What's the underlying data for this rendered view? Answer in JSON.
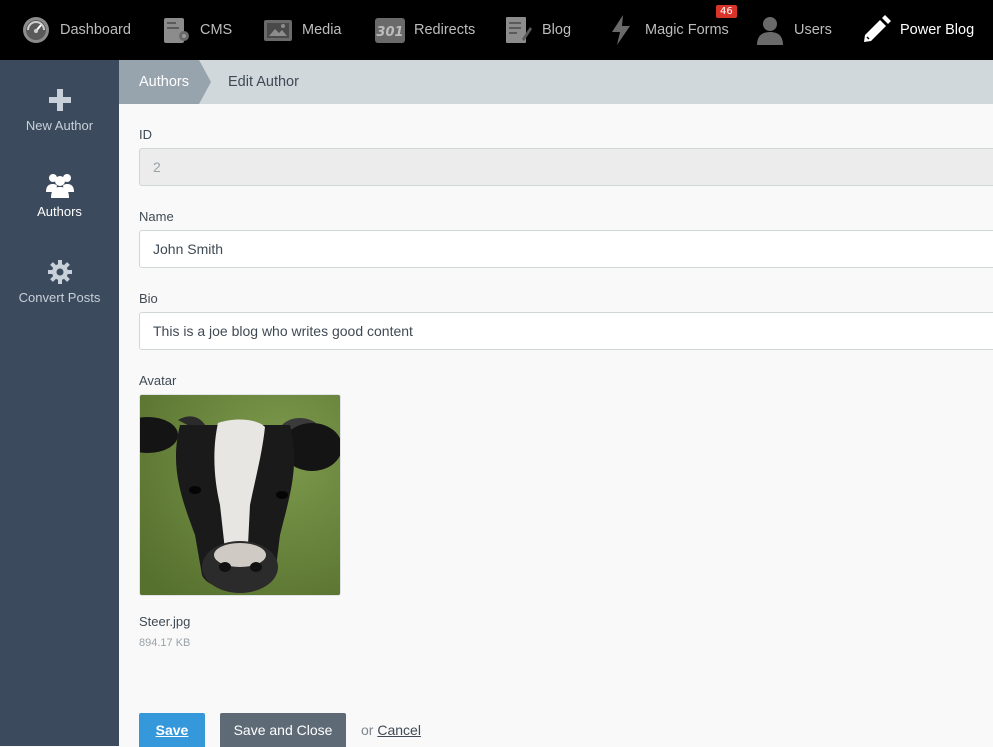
{
  "topnav": {
    "items": [
      {
        "label": "Dashboard",
        "icon": "dashboard-gauge-icon"
      },
      {
        "label": "CMS",
        "icon": "cms-icon"
      },
      {
        "label": "Media",
        "icon": "media-icon"
      },
      {
        "label": "Redirects",
        "icon": "redirects-icon",
        "icon_text": "301"
      },
      {
        "label": "Blog",
        "icon": "blog-icon"
      },
      {
        "label": "Magic Forms",
        "icon": "lightning-icon",
        "badge": "46"
      },
      {
        "label": "Users",
        "icon": "user-icon"
      },
      {
        "label": "Power Blog",
        "icon": "pencil-icon",
        "active": true
      }
    ]
  },
  "sidebar": {
    "items": [
      {
        "label": "New Author",
        "icon": "plus-icon"
      },
      {
        "label": "Authors",
        "icon": "users-icon",
        "active": true
      },
      {
        "label": "Convert Posts",
        "icon": "gear-icon"
      }
    ]
  },
  "breadcrumb": {
    "parent": "Authors",
    "current": "Edit Author"
  },
  "form": {
    "id_label": "ID",
    "id_value": "2",
    "name_label": "Name",
    "name_value": "John Smith",
    "bio_label": "Bio",
    "bio_value": "This is a joe blog who writes good content",
    "avatar_label": "Avatar",
    "avatar_file_name": "Steer.jpg",
    "avatar_file_size": "894.17 KB"
  },
  "actions": {
    "save_label": "Save",
    "save_close_label": "Save and Close",
    "or_text": "or",
    "cancel_label": "Cancel"
  },
  "colors": {
    "topnav_bg": "#000000",
    "sidebar_bg": "#3b4a5c",
    "breadcrumb_bg": "#d0d8dc",
    "primary": "#3498db",
    "badge": "#d9342b"
  }
}
